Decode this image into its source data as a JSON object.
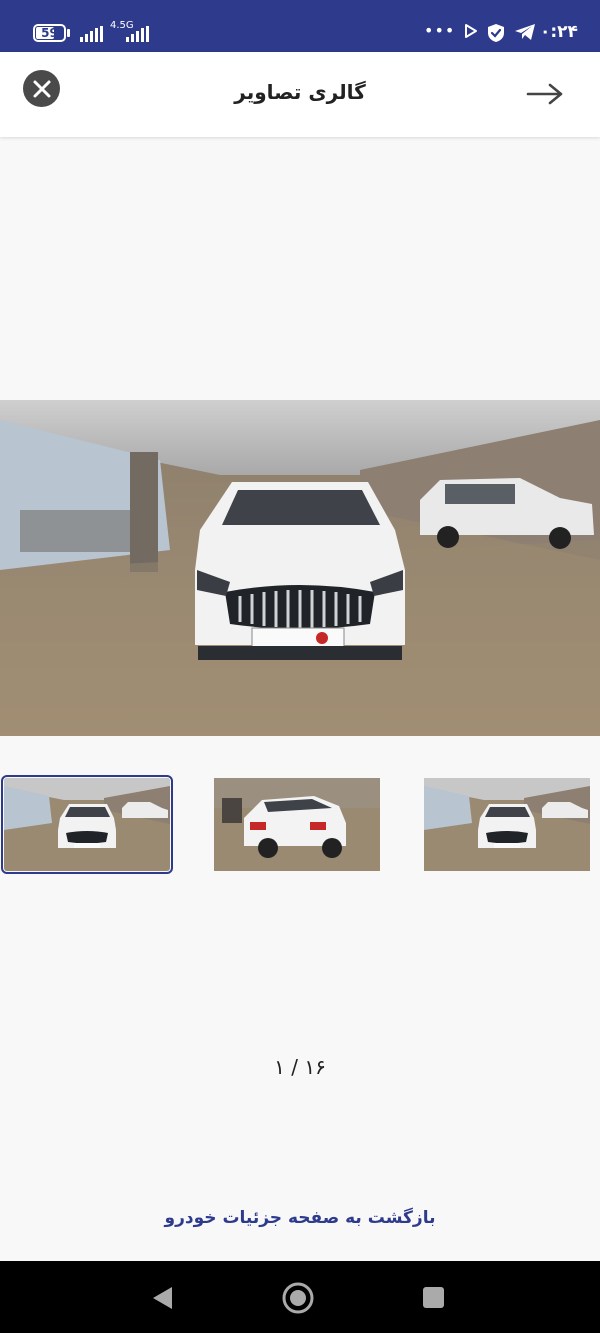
{
  "status_bar": {
    "battery": "59",
    "network": "4.5G",
    "dots": "•••",
    "time": "۰:۲۴",
    "icons": [
      "battery-icon",
      "signal-icon",
      "signal-icon",
      "more-dots-icon",
      "play-icon",
      "shield-icon",
      "telegram-icon"
    ]
  },
  "header": {
    "title": "گالری تصاویر",
    "close_icon": "close-icon",
    "back_icon": "arrow-right-icon"
  },
  "gallery": {
    "current_index": 1,
    "counter": "۱ / ۱۶",
    "thumbnails": [
      {
        "name": "thumbnail-front-view",
        "selected": true
      },
      {
        "name": "thumbnail-rear-view",
        "selected": false
      },
      {
        "name": "thumbnail-front-view",
        "selected": false
      }
    ]
  },
  "footer": {
    "back_link": "بازگشت به صفحه جزئیات خودرو"
  },
  "colors": {
    "primary": "#2e3a8c",
    "background": "#f8f8f8"
  }
}
